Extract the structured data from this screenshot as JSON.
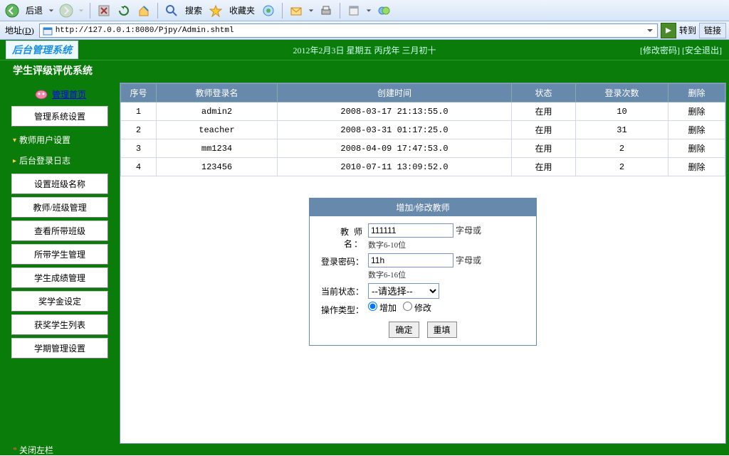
{
  "browser": {
    "back": "后退",
    "search": "搜索",
    "fav": "收藏夹",
    "addr_label": "地址",
    "url": "http://127.0.0.1:8080/Pjpy/Admin.shtml",
    "go": "转到",
    "links": "链接"
  },
  "header": {
    "logo": "后台管理系统",
    "datetime": "2012年2月3日 星期五 丙戌年 三月初十",
    "change_pw": "[修改密码]",
    "logout": "[安全退出]"
  },
  "subheader": {
    "title": "学生评级评优系统"
  },
  "sidebar": {
    "home": "管理首页",
    "items": [
      {
        "label": "管理系统设置",
        "type": "item"
      },
      {
        "label": "教师用户设置",
        "type": "cat"
      },
      {
        "label": "后台登录日志",
        "type": "cat"
      },
      {
        "label": "设置班级名称",
        "type": "item"
      },
      {
        "label": "教师/班级管理",
        "type": "item"
      },
      {
        "label": "查看所带班级",
        "type": "item"
      },
      {
        "label": "所带学生管理",
        "type": "item"
      },
      {
        "label": "学生成绩管理",
        "type": "item"
      },
      {
        "label": "奖学金设定",
        "type": "item"
      },
      {
        "label": "获奖学生列表",
        "type": "item"
      },
      {
        "label": "学期管理设置",
        "type": "item"
      }
    ]
  },
  "table": {
    "headers": [
      "序号",
      "教师登录名",
      "创建时间",
      "状态",
      "登录次数",
      "删除"
    ],
    "rows": [
      {
        "seq": "1",
        "login": "admin2",
        "created": "2008-03-17 21:13:55.0",
        "status": "在用",
        "count": "10",
        "del": "删除"
      },
      {
        "seq": "2",
        "login": "teacher",
        "created": "2008-03-31 01:17:25.0",
        "status": "在用",
        "count": "31",
        "del": "删除"
      },
      {
        "seq": "3",
        "login": "mm1234",
        "created": "2008-04-09 17:47:53.0",
        "status": "在用",
        "count": "2",
        "del": "删除"
      },
      {
        "seq": "4",
        "login": "123456",
        "created": "2010-07-11 13:09:52.0",
        "status": "在用",
        "count": "2",
        "del": "删除"
      }
    ]
  },
  "form": {
    "title": "增加/修改教师",
    "name_label": "教 师 名：",
    "name_value": "111111",
    "name_hint": "字母或",
    "name_sub": "数字6-10位",
    "pw_label": "登录密码：",
    "pw_value": "11h",
    "pw_hint": "字母或",
    "pw_sub": "数字6-16位",
    "status_label": "当前状态：",
    "status_option": "--请选择--",
    "op_label": "操作类型：",
    "op_add": "增加",
    "op_mod": "修改",
    "btn_ok": "确定",
    "btn_reset": "重填"
  },
  "footer": {
    "close_left": "关闭左栏"
  }
}
